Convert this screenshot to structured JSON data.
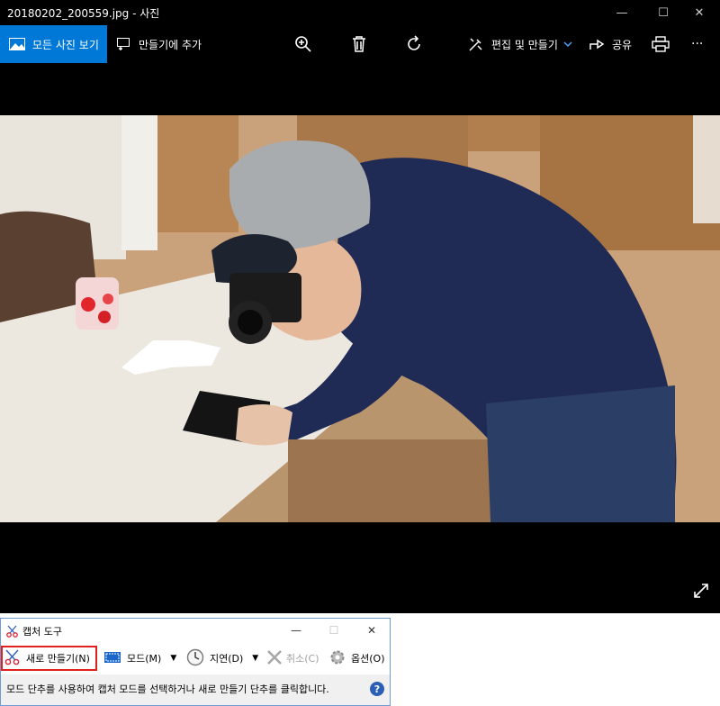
{
  "window": {
    "title": "20180202_200559.jpg - 사진",
    "controls": {
      "minimize": "—",
      "maximize": "☐",
      "close": "✕"
    }
  },
  "toolbar": {
    "all_photos": "모든 사진 보기",
    "add_to_creation": "만들기에 추가",
    "zoom_icon": "zoom-in-icon",
    "delete_icon": "trash-icon",
    "rotate_icon": "rotate-icon",
    "edit_create": "편집 및 만들기",
    "share": "공유",
    "print_icon": "printer-icon",
    "more": "···"
  },
  "viewer": {
    "expand_icon": "expand-icon",
    "accent": "#0078d7"
  },
  "snipping_tool": {
    "title": "캡처 도구",
    "controls": {
      "minimize": "—",
      "maximize": "☐",
      "close": "✕"
    },
    "new_label": "새로 만들기(N)",
    "mode_label": "모드(M)",
    "delay_label": "지연(D)",
    "cancel_label": "취소(C)",
    "options_label": "옵션(O)",
    "status_message": "모드 단추를 사용하여 캡처 모드를 선택하거나 새로 만들기 단추를 클릭합니다.",
    "help": "?"
  }
}
